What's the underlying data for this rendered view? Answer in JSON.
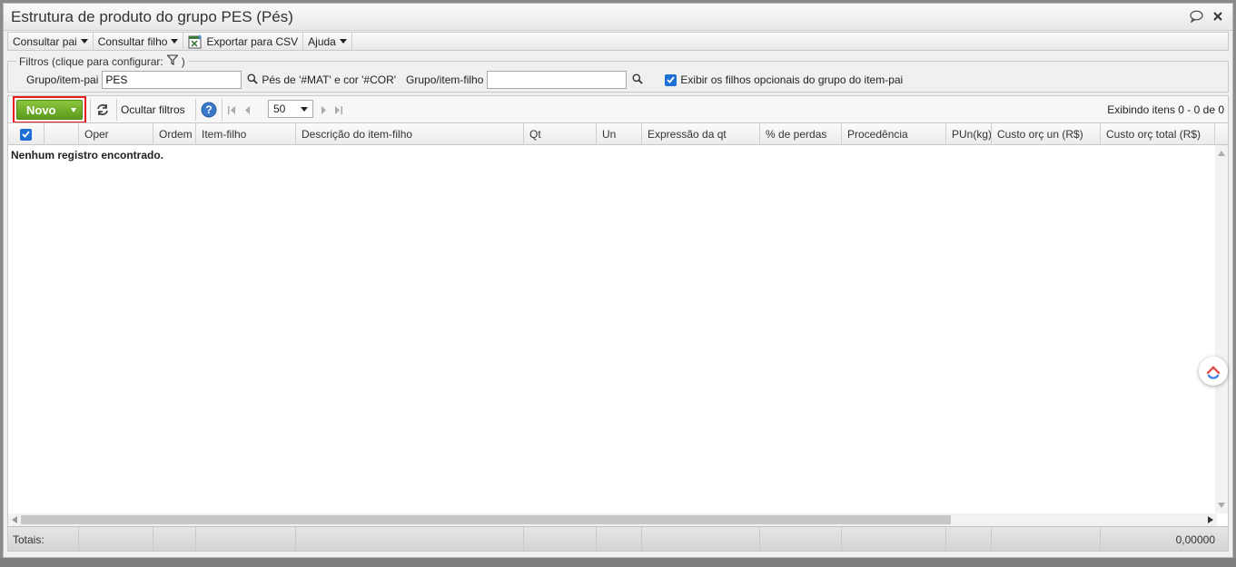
{
  "window": {
    "title": "Estrutura de produto do grupo PES (Pés)"
  },
  "menubar": {
    "consultar_pai": "Consultar pai",
    "consultar_filho": "Consultar filho",
    "exportar_csv": "Exportar para CSV",
    "ajuda": "Ajuda"
  },
  "filters": {
    "legend": "Filtros (clique para configurar:",
    "legend_close": ")",
    "grupo_pai_label": "Grupo/item-pai",
    "grupo_pai_value": "PES",
    "description": "Pés de '#MAT' e cor '#COR'",
    "grupo_filho_label": "Grupo/item-filho",
    "grupo_filho_value": "",
    "opcionais_label": "Exibir os filhos opcionais do grupo do item-pai",
    "opcionais_checked": true
  },
  "toolbar": {
    "novo_label": "Novo",
    "ocultar_filtros": "Ocultar filtros",
    "page_size": "50",
    "status": "Exibindo itens 0 - 0 de 0"
  },
  "grid": {
    "columns": [
      "Oper",
      "Ordem",
      "Item-filho",
      "Descrição do item-filho",
      "Qt",
      "Un",
      "Expressão da qt",
      "% de perdas",
      "Procedência",
      "PUn(kg)",
      "Custo orç un (R$)",
      "Custo orç total (R$)"
    ],
    "empty_message": "Nenhum registro encontrado.",
    "totals_label": "Totais:",
    "totals_value": "0,00000"
  },
  "colors": {
    "novo_green": "#6aab23",
    "highlight_red": "#e81e1e",
    "checkbox_blue": "#1d6fd6"
  }
}
